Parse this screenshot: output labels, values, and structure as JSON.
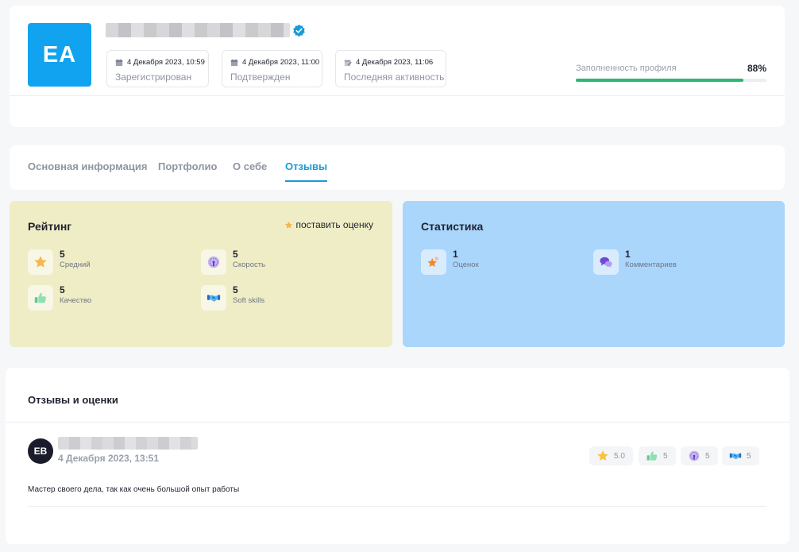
{
  "profile": {
    "avatar_initials": "EA",
    "dates": [
      {
        "date": "4 Декабря 2023, 10:59",
        "label": "Зарегистрирован",
        "icon": "calendar-icon"
      },
      {
        "date": "4 Декабря 2023, 11:00",
        "label": "Подтвержден",
        "icon": "calendar-icon"
      },
      {
        "date": "4 Декабря 2023, 11:06",
        "label": "Последняя активность",
        "icon": "edit-calendar-icon"
      }
    ],
    "completeness": {
      "label": "Заполненность профиля",
      "percent_text": "88%",
      "percent": 88
    }
  },
  "tabs": [
    {
      "label": "Основная информация",
      "active": false
    },
    {
      "label": "Портфолио",
      "active": false
    },
    {
      "label": "О себе",
      "active": false
    },
    {
      "label": "Отзывы",
      "active": true
    }
  ],
  "rating": {
    "title": "Рейтинг",
    "rate_link": "поставить оценку",
    "metrics": [
      {
        "value": "5",
        "label": "Средний",
        "icon": "star-icon"
      },
      {
        "value": "5",
        "label": "Скорость",
        "icon": "speedometer-icon"
      },
      {
        "value": "5",
        "label": "Качество",
        "icon": "thumbs-up-icon"
      },
      {
        "value": "5",
        "label": "Soft skills",
        "icon": "handshake-icon"
      }
    ]
  },
  "statistics": {
    "title": "Статистика",
    "metrics": [
      {
        "value": "1",
        "label": "Оценок",
        "icon": "star-rating-icon"
      },
      {
        "value": "1",
        "label": "Комментариев",
        "icon": "comments-icon"
      }
    ]
  },
  "reviews": {
    "title": "Отзывы и оценки",
    "items": [
      {
        "avatar_initials": "EB",
        "date": "4 Декабря 2023, 13:51",
        "text": "Мастер своего дела, так как очень большой опыт работы",
        "chips": [
          {
            "icon": "star-icon",
            "value": "5.0"
          },
          {
            "icon": "thumbs-up-icon",
            "value": "5"
          },
          {
            "icon": "speedometer-icon",
            "value": "5"
          },
          {
            "icon": "handshake-icon",
            "value": "5"
          }
        ]
      }
    ]
  },
  "colors": {
    "accent": "#1a9ad6",
    "avatar_bg": "#11a3f0",
    "progress": "#2bb673",
    "rating_panel": "#efedc5",
    "stats_panel": "#aad6fc"
  }
}
